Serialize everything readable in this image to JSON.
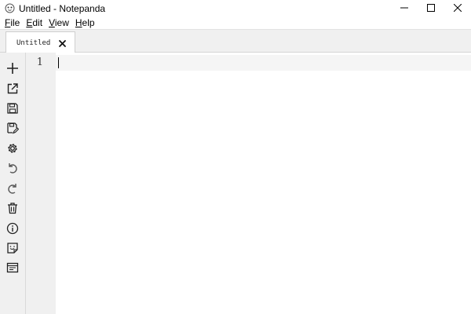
{
  "window": {
    "title": "Untitled - Notepanda",
    "app_icon": "notepanda-logo-icon",
    "controls": [
      "minimize-icon",
      "maximize-icon",
      "close-icon"
    ]
  },
  "menubar": {
    "items": [
      {
        "mnemonic": "F",
        "rest": "ile"
      },
      {
        "mnemonic": "E",
        "rest": "dit"
      },
      {
        "mnemonic": "V",
        "rest": "iew"
      },
      {
        "mnemonic": "H",
        "rest": "elp"
      }
    ]
  },
  "tabs": [
    {
      "label": "Untitled",
      "close_icon": "close-tab-icon"
    }
  ],
  "toolbar": {
    "icons": [
      "new-file-icon",
      "open-file-icon",
      "save-icon",
      "save-as-icon",
      "settings-icon",
      "undo-icon",
      "redo-icon",
      "delete-icon",
      "info-icon",
      "sticky-note-icon",
      "preview-icon"
    ]
  },
  "editor": {
    "line_numbers": [
      "1"
    ],
    "content": ""
  }
}
